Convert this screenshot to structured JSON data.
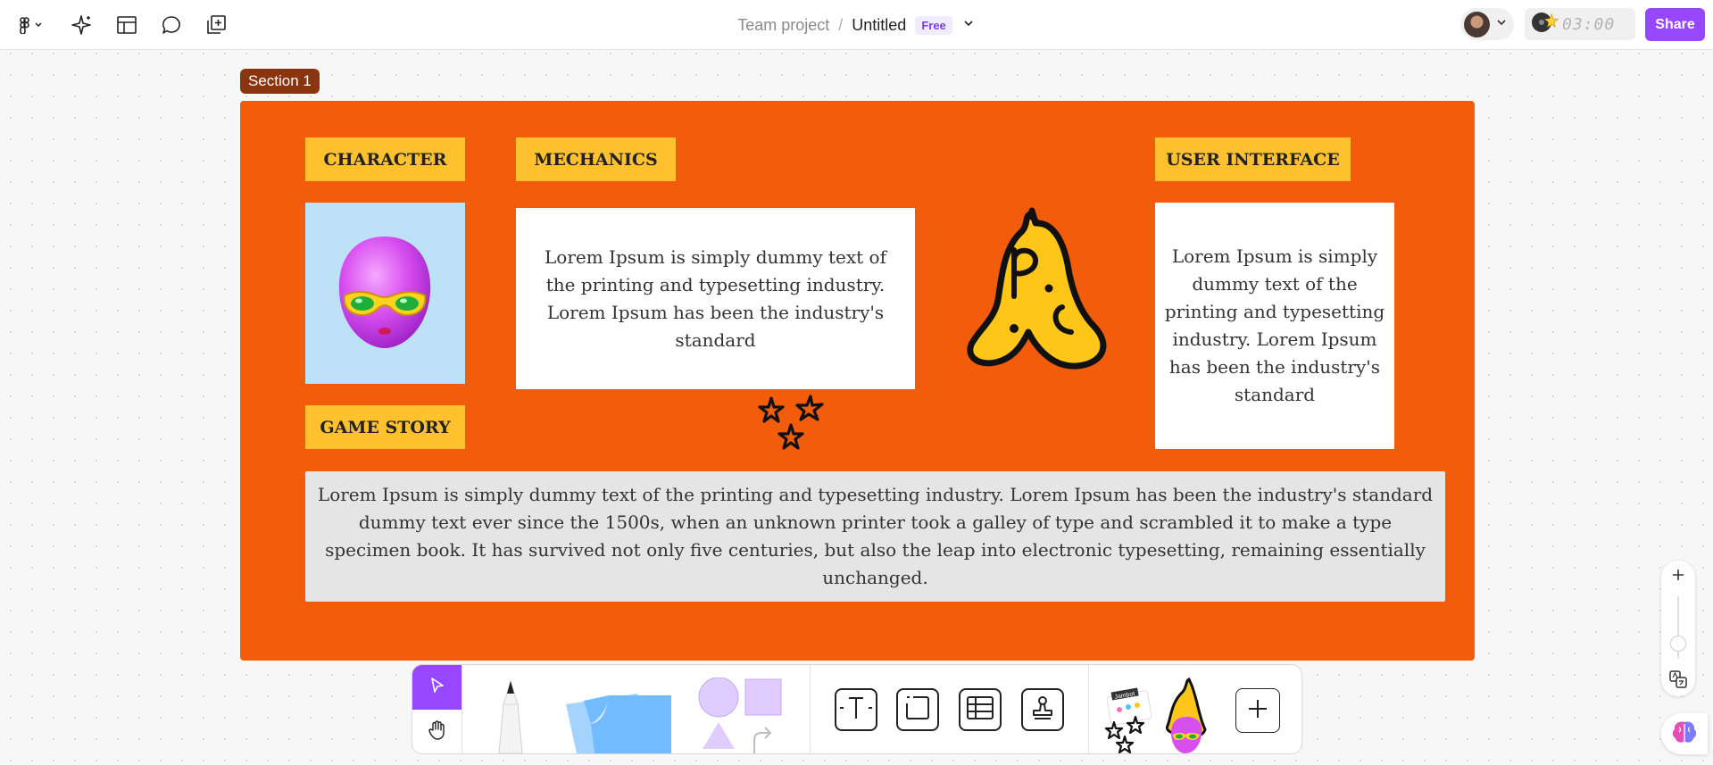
{
  "header": {
    "team": "Team project",
    "separator": "/",
    "file_name": "Untitled",
    "plan_badge": "Free",
    "timer": "03:00",
    "share_label": "Share"
  },
  "section": {
    "label": "Section 1",
    "background": "#f25c0a",
    "tags": {
      "character": "CHARACTER",
      "mechanics": "MECHANICS",
      "user_interface": "USER INTERFACE",
      "game_story": "GAME STORY"
    },
    "mechanics_text": "Lorem Ipsum is simply dummy text of the printing and typesetting industry. Lorem Ipsum has been the industry's standard",
    "ui_text": "Lorem Ipsum is simply dummy text of the printing and typesetting industry. Lorem Ipsum has been the industry's standard",
    "story_text": "Lorem Ipsum is simply dummy text of the printing and typesetting industry. Lorem Ipsum has been the industry's standard dummy text ever since the 1500s, when an unknown printer took a galley of type and scrambled it to make a type specimen book. It has survived not only five centuries, but also the leap into electronic typesetting, remaining essentially unchanged."
  },
  "toolbar": {
    "sticker_pack_label": "Jambot"
  },
  "colors": {
    "accent": "#9747ff",
    "tag_yellow": "#ffc12d",
    "section_label_bg": "#8a3410"
  }
}
